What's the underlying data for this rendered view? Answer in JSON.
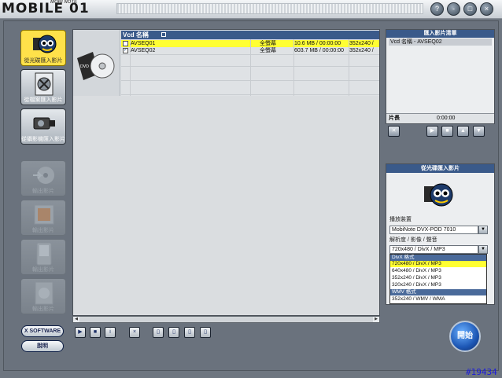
{
  "titlebar": {
    "logo": "MOBILE 01",
    "logo_sub": "MOBI NOTE",
    "buttons": [
      "?",
      "-",
      "□",
      "×"
    ]
  },
  "sidebar": {
    "items": [
      {
        "label": "從光碟匯入影片",
        "state": "active",
        "icon": "disc-eye-icon"
      },
      {
        "label": "從檔案匯入影片",
        "state": "normal",
        "icon": "file-tool-icon"
      },
      {
        "label": "從攝影機匯入影片",
        "state": "normal",
        "icon": "camcorder-icon"
      },
      {
        "label": "輸出影片",
        "state": "disabled",
        "icon": "disc-export-icon"
      },
      {
        "label": "輸出影片",
        "state": "disabled",
        "icon": "frame-icon"
      },
      {
        "label": "輸出影片",
        "state": "disabled",
        "icon": "pda-icon"
      },
      {
        "label": "輸出影片",
        "state": "disabled",
        "icon": "file-export-icon"
      }
    ],
    "x_software_label": "X SOFTWARE",
    "help_label": "說明"
  },
  "file_list": {
    "header": "Vcd 名稱",
    "rows": [
      {
        "checked": false,
        "name": "AVSEQ01",
        "mode": "全螢幕",
        "size": "10.6 MB / 00:00:00",
        "res": "352x240 /",
        "selected": true
      },
      {
        "checked": true,
        "name": "AVSEQ02",
        "mode": "全螢幕",
        "size": "603.7 MB / 00:00:00",
        "res": "352x240 /",
        "selected": false
      }
    ]
  },
  "toolbar": {
    "buttons": [
      "play-button",
      "stop-button",
      "info-button",
      "delete-button",
      "view1-button",
      "view2-button",
      "view3-button",
      "view4-button"
    ]
  },
  "import_list": {
    "title": "匯入影片清單",
    "items": [
      "Vcd 名稱 - AVSEQ02"
    ],
    "length_label": "片長",
    "length_value": "0:00:00"
  },
  "disc_import": {
    "title": "從光碟匯入影片",
    "device_label": "播放裝置",
    "device_value": "MobiNote DVX-POD 7010",
    "format_label": "解析度 / 影像 / 聲音",
    "format_value": "720x480 / DivX / MP3",
    "options": [
      {
        "text": "DivX 格式",
        "group": true
      },
      {
        "text": "720x480 / DivX / MP3",
        "selected": true
      },
      {
        "text": "640x480 / DivX / MP3"
      },
      {
        "text": "352x240 / DivX / MP3"
      },
      {
        "text": "320x240 / DivX / MP3"
      },
      {
        "text": "WMV 格式",
        "group": true
      },
      {
        "text": "352x240 / WMV / WMA"
      }
    ]
  },
  "start_label": "開始",
  "watermark": "#19434"
}
